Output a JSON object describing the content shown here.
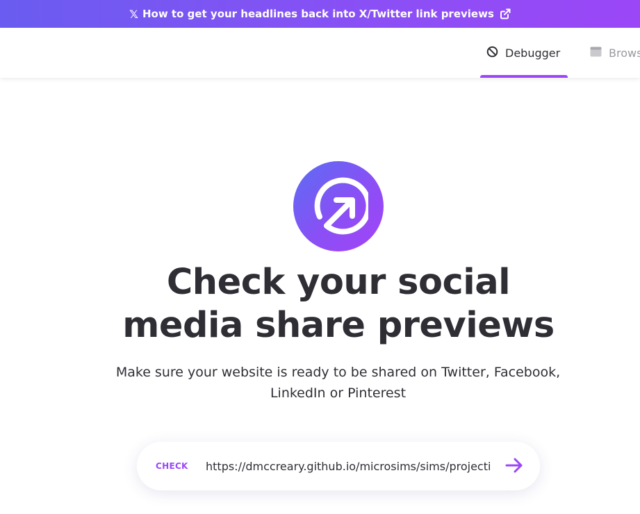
{
  "banner": {
    "icon": "x-logo-icon",
    "text": "How to get your headlines back into X/Twitter link previews",
    "trailing_icon": "external-link-icon"
  },
  "nav": {
    "tabs": [
      {
        "label": "Debugger",
        "icon": "debug-icon",
        "active": true
      },
      {
        "label": "Browser",
        "icon": "browser-window-icon",
        "active": false
      }
    ]
  },
  "hero": {
    "logo_icon": "arrow-up-right-circle-icon",
    "headline_line1": "Check your social",
    "headline_line2": "media share previews",
    "subtitle": "Make sure your website is ready to be shared on Twitter, Facebook, LinkedIn or Pinterest"
  },
  "search": {
    "label": "CHECK",
    "value": "https://dmccreary.github.io/microsims/sims/projecti",
    "submit_icon": "arrow-right-icon"
  },
  "colors": {
    "accent": "#9b47f7",
    "gradient_start": "#6a5cf0",
    "text": "#2f2e35",
    "muted": "#9a9aa0"
  }
}
